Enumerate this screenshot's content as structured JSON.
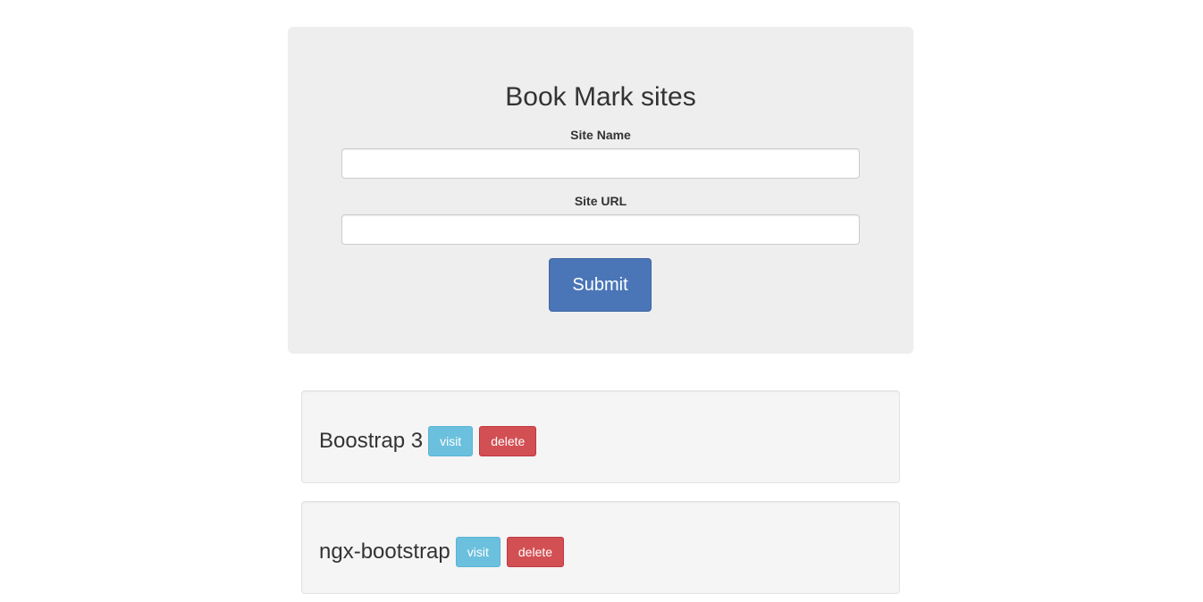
{
  "form": {
    "title": "Book Mark sites",
    "site_name_label": "Site Name",
    "site_name_value": "",
    "site_url_label": "Site URL",
    "site_url_value": "",
    "submit_label": "Submit"
  },
  "bookmarks": [
    {
      "name": "Boostrap 3",
      "visit_label": "visit",
      "delete_label": "delete"
    },
    {
      "name": "ngx-bootstrap",
      "visit_label": "visit",
      "delete_label": "delete"
    }
  ],
  "colors": {
    "panel_bg": "#eeeeee",
    "primary": "#4a76b8",
    "info": "#6bc0de",
    "danger": "#d24f53",
    "well_bg": "#f5f5f5"
  }
}
